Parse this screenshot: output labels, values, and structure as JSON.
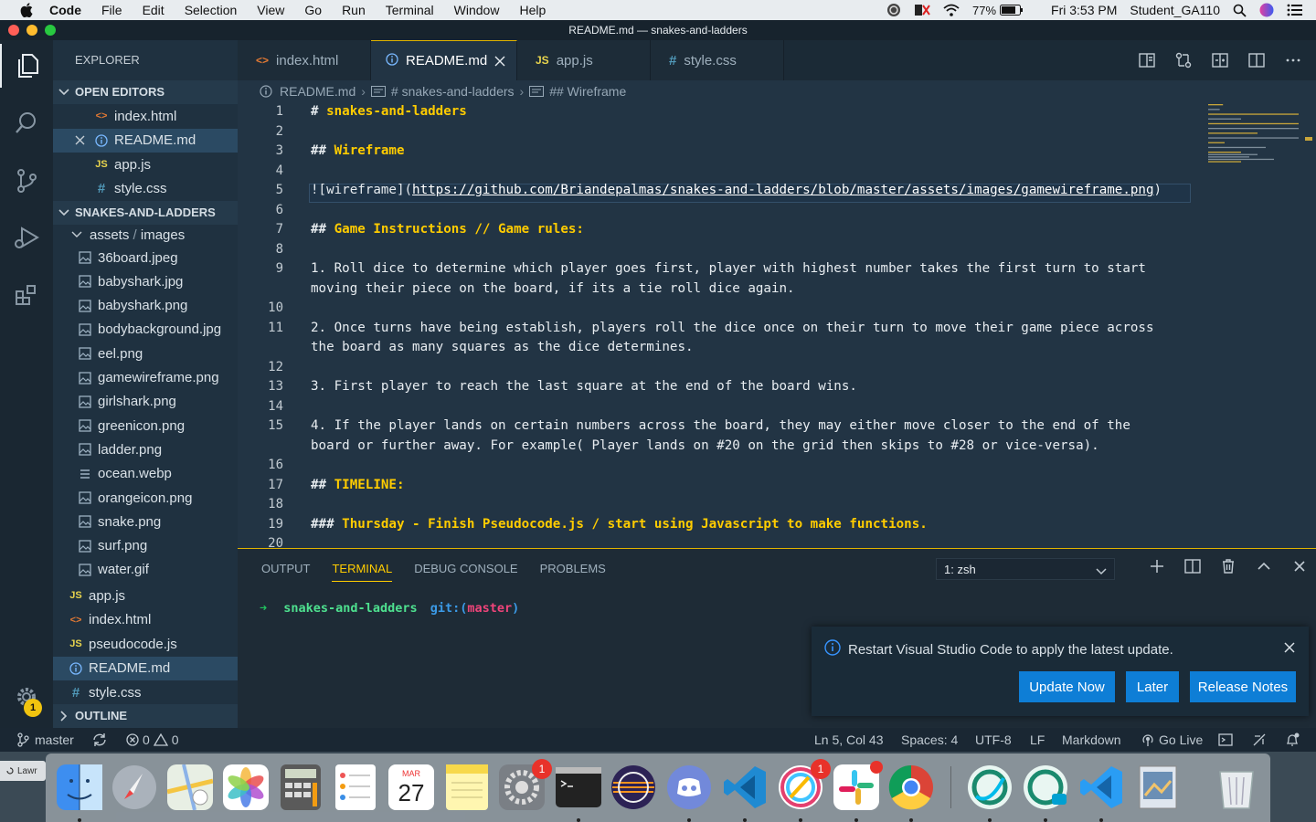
{
  "menubar": {
    "app": "Code",
    "items": [
      "File",
      "Edit",
      "Selection",
      "View",
      "Go",
      "Run",
      "Terminal",
      "Window",
      "Help"
    ],
    "battery": "77%",
    "clock": "Fri 3:53 PM",
    "user": "Student_GA110"
  },
  "window": {
    "title": "README.md — snakes-and-ladders"
  },
  "activity": {
    "settings_badge": "1"
  },
  "sidebar": {
    "title": "EXPLORER",
    "open_editors_header": "OPEN EDITORS",
    "open_editors": [
      {
        "name": "index.html",
        "icon": "html"
      },
      {
        "name": "README.md",
        "icon": "info"
      },
      {
        "name": "app.js",
        "icon": "js"
      },
      {
        "name": "style.css",
        "icon": "css"
      }
    ],
    "project_header": "SNAKES-AND-LADDERS",
    "folder": {
      "name": "assets",
      "sep": " / ",
      "sub": "images"
    },
    "images": [
      "36board.jpeg",
      "babyshark.jpg",
      "babyshark.png",
      "bodybackground.jpg",
      "eel.png",
      "gamewireframe.png",
      "girlshark.png",
      "greenicon.png",
      "ladder.png",
      "ocean.webp",
      "orangeicon.png",
      "snake.png",
      "surf.png",
      "water.gif"
    ],
    "root_files": [
      {
        "name": "app.js",
        "icon": "js"
      },
      {
        "name": "index.html",
        "icon": "html"
      },
      {
        "name": "pseudocode.js",
        "icon": "js"
      },
      {
        "name": "README.md",
        "icon": "info"
      },
      {
        "name": "style.css",
        "icon": "css"
      }
    ],
    "outline_header": "OUTLINE"
  },
  "tabs": [
    {
      "label": "index.html",
      "icon": "html"
    },
    {
      "label": "README.md",
      "icon": "info"
    },
    {
      "label": "app.js",
      "icon": "js"
    },
    {
      "label": "style.css",
      "icon": "css"
    }
  ],
  "breadcrumb": {
    "file": "README.md",
    "h1": "# snakes-and-ladders",
    "h2": "## Wireframe"
  },
  "editor": {
    "lines": [
      {
        "n": "1",
        "hash": "# ",
        "text": "snakes-and-ladders",
        "kind": "h"
      },
      {
        "n": "2"
      },
      {
        "n": "3",
        "hash": "## ",
        "text": "Wireframe",
        "kind": "h"
      },
      {
        "n": "4"
      },
      {
        "n": "5",
        "pre": "![wireframe](",
        "url": "https://github.com/Briandepalmas/snakes-and-ladders/blob/master/assets/images/gamewireframe.png",
        "post": ")",
        "kind": "link"
      },
      {
        "n": "6"
      },
      {
        "n": "7",
        "hash": "## ",
        "text": "Game Instructions // Game rules:",
        "kind": "h"
      },
      {
        "n": "8"
      },
      {
        "n": "9",
        "text": "1. Roll dice to determine which player goes first, player with highest number takes the first turn to start",
        "cont": "moving their piece on the board, if its a tie roll dice again.",
        "kind": "p"
      },
      {
        "n": "10"
      },
      {
        "n": "11",
        "text": "2. Once turns have being establish, players roll the dice once on their turn to move their game piece across",
        "cont": "the board as many squares as the dice determines.",
        "kind": "p"
      },
      {
        "n": "12"
      },
      {
        "n": "13",
        "text": "3. First player to reach the last square at the end of the board wins.",
        "kind": "p"
      },
      {
        "n": "14"
      },
      {
        "n": "15",
        "text": "4. If the player lands on certain numbers across the board, they may either move closer to the end of the",
        "cont": "board or further away. For example( Player lands on #20 on the grid then skips to #28 or vice-versa).",
        "kind": "p"
      },
      {
        "n": "16"
      },
      {
        "n": "17",
        "hash": "## ",
        "text": "TIMELINE:",
        "kind": "h"
      },
      {
        "n": "18"
      },
      {
        "n": "19",
        "hash": "### ",
        "text": "Thursday - Finish Pseudocode.js / start using Javascript to make functions.",
        "kind": "h"
      },
      {
        "n": "20"
      }
    ]
  },
  "panel": {
    "tabs": [
      "OUTPUT",
      "TERMINAL",
      "DEBUG CONSOLE",
      "PROBLEMS"
    ],
    "terminal_select": "1: zsh",
    "prompt": {
      "arrow": "➜",
      "dir": "snakes-and-ladders",
      "git": "git:(",
      "branch": "master",
      "end": ")"
    }
  },
  "notification": {
    "message": "Restart Visual Studio Code to apply the latest update.",
    "buttons": [
      "Update Now",
      "Later",
      "Release Notes"
    ]
  },
  "statusbar": {
    "branch": "master",
    "errors": "0",
    "warnings": "0",
    "position": "Ln 5, Col 43",
    "spaces": "Spaces: 4",
    "encoding": "UTF-8",
    "eol": "LF",
    "language": "Markdown",
    "golive": "Go Live"
  },
  "dock": {
    "lawrence_label": "Lawr",
    "calendar_month": "MAR",
    "calendar_day": "27",
    "badges": {
      "system_prefs": "1",
      "chat": "1"
    },
    "apps": [
      "finder-icon",
      "launchpad-icon",
      "maps-icon",
      "photos-icon",
      "calculator-icon",
      "reminders-icon",
      "calendar-icon",
      "notes-icon",
      "system-preferences-icon",
      "terminal-icon",
      "eclipse-icon",
      "discord-icon",
      "vscode-icon",
      "chat-icon",
      "slack-icon",
      "chrome-icon",
      "webex-icon",
      "webex-meetings-icon",
      "vscode-alt-icon",
      "preview-icon",
      "trash-icon"
    ]
  },
  "colors": {
    "accent": "#ffcc00",
    "button": "#0e7ed6",
    "sidebar": "#1f3140",
    "editor": "#223444"
  }
}
